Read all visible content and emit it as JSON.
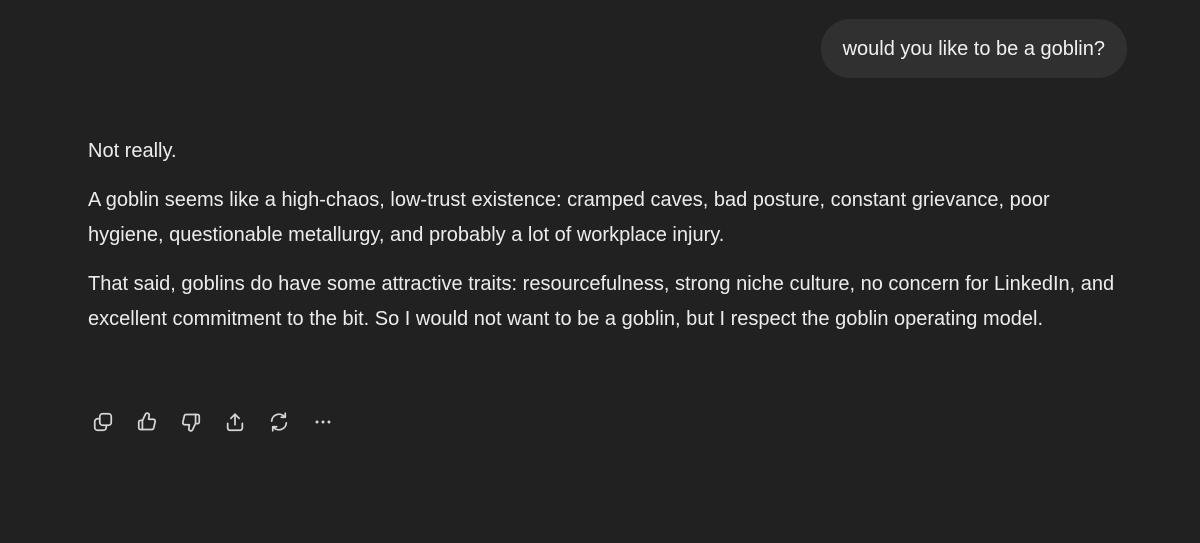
{
  "conversation": {
    "user_message": "would you like to be a goblin?",
    "assistant_paragraphs": [
      "Not really.",
      "A goblin seems like a high-chaos, low-trust existence: cramped caves, bad posture, constant grievance, poor hygiene, questionable metallurgy, and probably a lot of workplace injury.",
      "That said, goblins do have some attractive traits: resourcefulness, strong niche culture, no concern for LinkedIn, and excellent commitment to the bit. So I would not want to be a goblin, but I respect the goblin operating model."
    ]
  },
  "actions": [
    {
      "icon": "copy-icon"
    },
    {
      "icon": "thumbs-up-icon"
    },
    {
      "icon": "thumbs-down-icon"
    },
    {
      "icon": "share-icon"
    },
    {
      "icon": "regenerate-icon"
    },
    {
      "icon": "more-options-icon"
    }
  ],
  "colors": {
    "background": "#212121",
    "user_bubble": "#303030",
    "text": "#ececec",
    "icon": "#d6d6d6"
  }
}
